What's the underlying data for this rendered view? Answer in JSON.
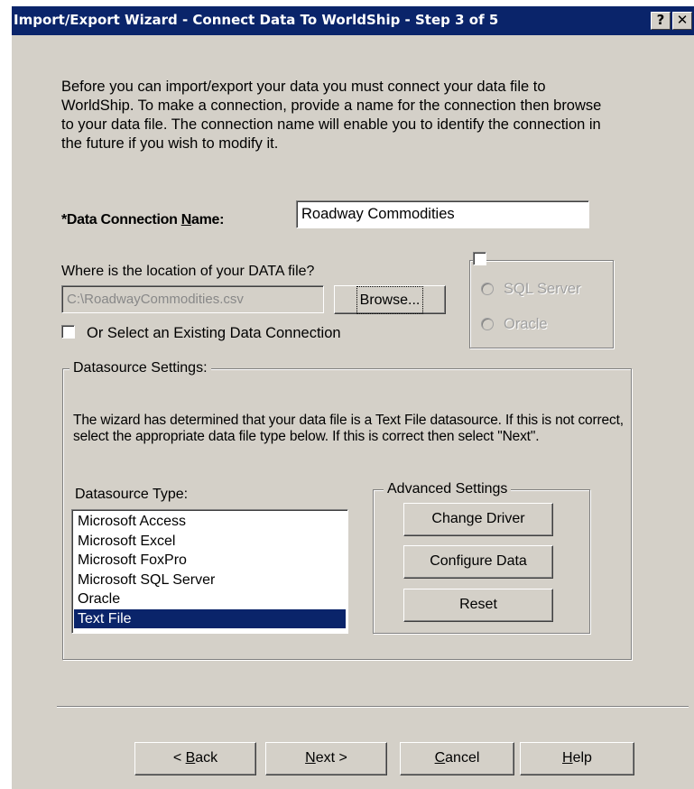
{
  "window": {
    "title": "Import/Export Wizard - Connect Data To WorldShip - Step 3 of 5",
    "help_button": "?",
    "close_button": "✕"
  },
  "intro_text": "Before you can import/export your data you must connect your data file to WorldShip. To make a connection, provide a name for the connection then browse to your data file. The connection name will enable you to identify the connection in the future if you wish to modify it.",
  "connection_name": {
    "label_pre": "*Data Connection ",
    "label_key": "N",
    "label_post": "ame:",
    "value": "Roadway Commodities"
  },
  "data_file": {
    "label": "Where is the location of your DATA file?",
    "path": "C:\\RoadwayCommodities.csv",
    "browse_label": "Browse..."
  },
  "existing_connection": {
    "label": "Or Select an Existing Data Connection",
    "checked": false
  },
  "db_type": {
    "sql_server": "SQL Server",
    "oracle": "Oracle"
  },
  "datasource_settings": {
    "legend": "Datasource Settings:",
    "description": "The wizard has determined that your data file is a Text File datasource. If this is not correct, select the appropriate data file type below. If this is correct then select \"Next\".",
    "type_label": "Datasource Type:",
    "types": [
      "Microsoft Access",
      "Microsoft Excel",
      "Microsoft FoxPro",
      "Microsoft SQL Server",
      "Oracle",
      "Text File"
    ],
    "selected": "Text File"
  },
  "advanced_settings": {
    "legend": "Advanced Settings",
    "change_driver": "Change Driver",
    "configure_data": "Configure Data",
    "reset": "Reset"
  },
  "footer": {
    "back_pre": "< ",
    "back_key": "B",
    "back_post": "ack",
    "next_key": "N",
    "next_post": "ext >",
    "cancel_key": "C",
    "cancel_post": "ancel",
    "help_key": "H",
    "help_post": "elp"
  },
  "colors": {
    "titlebar": "#0a246a",
    "dialog_bg": "#d4d0c8",
    "selection": "#0a246a"
  }
}
